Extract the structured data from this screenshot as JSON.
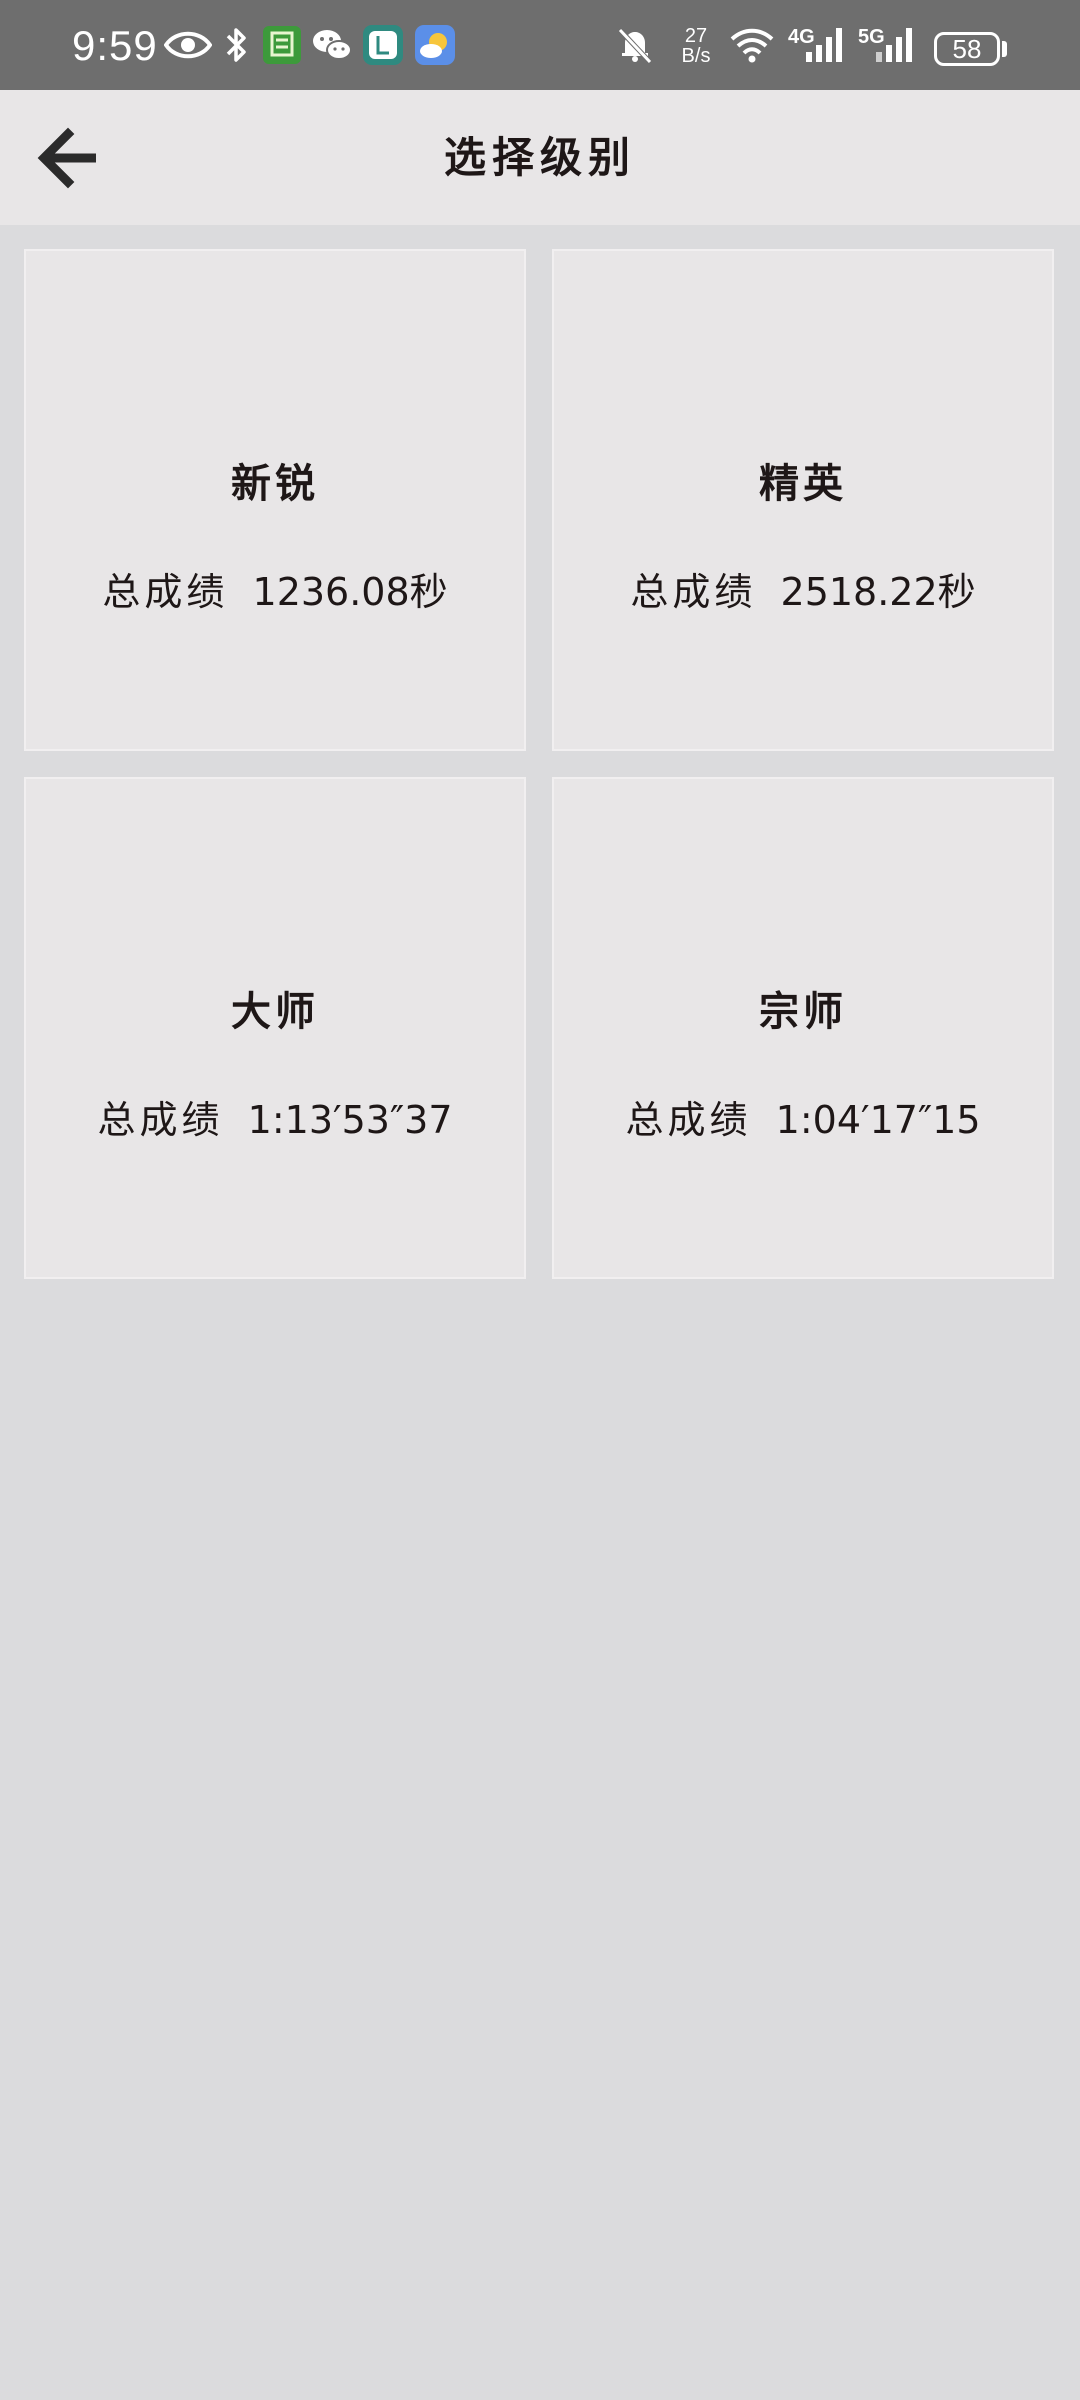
{
  "status_bar": {
    "time": "9:59",
    "net_speed_value": "27",
    "net_speed_unit": "B/s",
    "net_4g_label": "4G",
    "net_5g_label": "5G",
    "battery": "58",
    "icons": [
      "eye-icon",
      "bluetooth-icon",
      "reading-app-icon",
      "wechat-icon",
      "app-icon",
      "weather-icon",
      "mute-icon",
      "wifi-icon",
      "signal-4g-icon",
      "signal-5g-icon",
      "battery-icon"
    ]
  },
  "header": {
    "title": "选择级别",
    "back_icon": "arrow-left-icon"
  },
  "levels": [
    {
      "name": "新锐",
      "score_label": "总成绩",
      "score_value": "1236.08秒"
    },
    {
      "name": "精英",
      "score_label": "总成绩",
      "score_value": "2518.22秒"
    },
    {
      "name": "大师",
      "score_label": "总成绩",
      "score_value": "1:13′53″37"
    },
    {
      "name": "宗师",
      "score_label": "总成绩",
      "score_value": "1:04′17″15"
    }
  ],
  "colors": {
    "status_bar_bg": "#6e6e6e",
    "header_bg": "#e8e6e7",
    "page_bg": "#dbdbdd",
    "card_bg": "#e8e6e7",
    "text": "#1e1717"
  }
}
